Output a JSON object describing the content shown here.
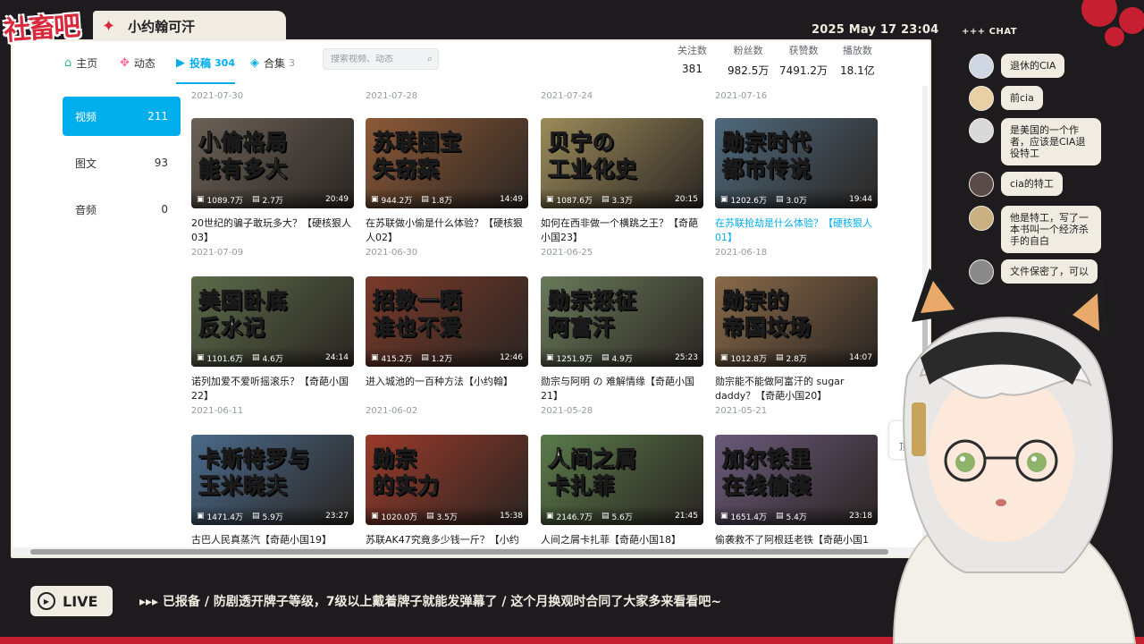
{
  "overlay": {
    "logo_text": "社畜吧",
    "stream_title": "小约翰可汗",
    "datetime": "2025 May 17 23:04",
    "chat_header": "+++ CHAT",
    "live_label": "LIVE",
    "ticker": "▸▸▸  已报备  /  防剧透开牌子等级，7级以上戴着牌子就能发弹幕了  /  这个月换观时合同了大家多来看看吧~"
  },
  "nav": {
    "tabs": [
      {
        "label": "主页",
        "icon": "home-icon",
        "count": ""
      },
      {
        "label": "动态",
        "icon": "dynamic-icon",
        "count": ""
      },
      {
        "label": "投稿",
        "icon": "upload-icon",
        "count": "304"
      },
      {
        "label": "合集",
        "icon": "collection-icon",
        "count": "3"
      }
    ],
    "search_placeholder": "搜索视频、动态",
    "stats": [
      {
        "label": "关注数",
        "value": "381"
      },
      {
        "label": "粉丝数",
        "value": "982.5万"
      },
      {
        "label": "获赞数",
        "value": "7491.2万"
      },
      {
        "label": "播放数",
        "value": "18.1亿"
      }
    ]
  },
  "side": [
    {
      "label": "视频",
      "count": "211"
    },
    {
      "label": "图文",
      "count": "93"
    },
    {
      "label": "音频",
      "count": "0"
    }
  ],
  "top_dates": [
    "2021-07-30",
    "2021-07-28",
    "2021-07-24",
    "2021-07-16"
  ],
  "videos": [
    {
      "cover": "小偷格局\n能有多大",
      "plays": "1089.7万",
      "danmaku": "2.7万",
      "duration": "20:49",
      "title": "20世纪的骗子敢玩多大？【硬核狠人03】",
      "date": "2021-07-09",
      "color": "#6b6257"
    },
    {
      "cover": "苏联国宝\n失窃案",
      "plays": "944.2万",
      "danmaku": "1.8万",
      "duration": "14:49",
      "title": "在苏联做小偷是什么体验？【硬核狠人02】",
      "date": "2021-06-30",
      "color": "#8d5a37"
    },
    {
      "cover": "贝宁の\n工业化史",
      "plays": "1087.6万",
      "danmaku": "3.3万",
      "duration": "20:15",
      "title": "如何在西非做一个横跳之王？【奇葩小国23】",
      "date": "2021-06-25",
      "color": "#9c8c5a"
    },
    {
      "cover": "勋宗时代\n都市传说",
      "plays": "1202.6万",
      "danmaku": "3.0万",
      "duration": "19:44",
      "title": "在苏联抢劫是什么体验？【硬核狠人01】",
      "date": "2021-06-18",
      "color": "#4f6a7d"
    },
    {
      "cover": "美国卧底\n反水记",
      "plays": "1101.6万",
      "danmaku": "4.6万",
      "duration": "24:14",
      "title": "诺列加爱不爱听摇滚乐？【奇葩小国22】",
      "date": "2021-06-11",
      "color": "#5c6b4a"
    },
    {
      "cover": "招数一晒\n谁也不爱",
      "plays": "415.2万",
      "danmaku": "1.2万",
      "duration": "12:46",
      "title": "进入城池的一百种方法【小约翰】",
      "date": "2021-06-02",
      "color": "#7a3a2a"
    },
    {
      "cover": "勋宗怒征\n阿富汗",
      "plays": "1251.9万",
      "danmaku": "4.9万",
      "duration": "25:23",
      "title": "勋宗与阿明 の 难解情缘【奇葩小国21】",
      "date": "2021-05-28",
      "color": "#6a7a5a"
    },
    {
      "cover": "勋宗的\n帝国坟场",
      "plays": "1012.8万",
      "danmaku": "2.8万",
      "duration": "14:07",
      "title": "勋宗能不能做阿富汗的 sugar daddy？【奇葩小国20】",
      "date": "2021-05-21",
      "color": "#8a6a4a"
    },
    {
      "cover": "卡斯特罗与\n玉米晓夫",
      "plays": "1471.4万",
      "danmaku": "5.9万",
      "duration": "23:27",
      "title": "古巴人民真蒸汽【奇葩小国19】",
      "date": "",
      "color": "#4a6a8a"
    },
    {
      "cover": "勋宗\n的实力",
      "plays": "1020.0万",
      "danmaku": "3.5万",
      "duration": "15:38",
      "title": "苏联AK47究竟多少钱一斤？【小约",
      "date": "",
      "color": "#9a3a2a"
    },
    {
      "cover": "人间之屑\n卡扎菲",
      "plays": "2146.7万",
      "danmaku": "5.6万",
      "duration": "21:45",
      "title": "人间之屑卡扎菲【奇葩小国18】",
      "date": "",
      "color": "#5a7a4a"
    },
    {
      "cover": "加尔铁里\n在线偷袭",
      "plays": "1651.4万",
      "danmaku": "5.4万",
      "duration": "23:18",
      "title": "偷袭救不了阿根廷老铁【奇葩小国1",
      "date": "",
      "color": "#6a5a7a"
    }
  ],
  "back_top_label": "顶部",
  "chat": [
    {
      "text": "退休的CIA",
      "color": "#cfd6e4"
    },
    {
      "text": "前cia",
      "color": "#e8cfa4"
    },
    {
      "text": "是美国的一个作者，应该是CIA退役特工",
      "color": "#d9d9d9"
    },
    {
      "text": "cia的特工",
      "color": "#5a4a4a"
    },
    {
      "text": "他是特工，写了一本书叫一个经济杀手的自白",
      "color": "#c8b080"
    },
    {
      "text": "文件保密了，可以",
      "color": "#8a8a8a"
    }
  ]
}
